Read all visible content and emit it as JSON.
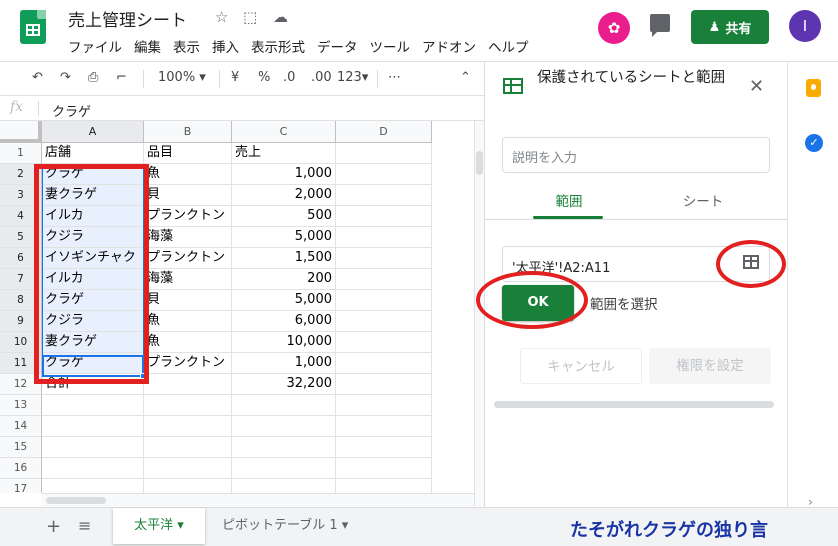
{
  "app": {
    "title": "売上管理シート",
    "menus": [
      "ファイル",
      "編集",
      "表示",
      "挿入",
      "表示形式",
      "データ",
      "ツール",
      "アドオン",
      "ヘルプ"
    ],
    "share_label": "共有",
    "user_initial": "I"
  },
  "toolbar": {
    "zoom": "100%",
    "currency": "¥",
    "percent": "%",
    "dec_less": ".0",
    "dec_more": ".00",
    "format": "123"
  },
  "formula": {
    "fx": "fx",
    "value": "クラゲ"
  },
  "grid": {
    "columns": [
      "A",
      "B",
      "C",
      "D"
    ],
    "rows": [
      "1",
      "2",
      "3",
      "4",
      "5",
      "6",
      "7",
      "8",
      "9",
      "10",
      "11",
      "12",
      "13",
      "14",
      "15",
      "16",
      "17"
    ],
    "data": [
      [
        "店舗",
        "品目",
        "売上"
      ],
      [
        "クラゲ",
        "魚",
        "1,000"
      ],
      [
        "妻クラゲ",
        "貝",
        "2,000"
      ],
      [
        "イルカ",
        "プランクトン",
        "500"
      ],
      [
        "クジラ",
        "海藻",
        "5,000"
      ],
      [
        "イソギンチャク",
        "プランクトン",
        "1,500"
      ],
      [
        "イルカ",
        "海藻",
        "200"
      ],
      [
        "クラゲ",
        "貝",
        "5,000"
      ],
      [
        "クジラ",
        "魚",
        "6,000"
      ],
      [
        "妻クラゲ",
        "魚",
        "10,000"
      ],
      [
        "クラゲ",
        "プランクトン",
        "1,000"
      ],
      [
        "合計",
        "",
        "32,200"
      ]
    ]
  },
  "sheets": {
    "active": "太平洋",
    "other": "ピボットテーブル 1"
  },
  "watermark": "たそがれクラゲの独り言",
  "panel": {
    "title": "保護されているシートと範囲",
    "desc_placeholder": "説明を入力",
    "tab_range": "範囲",
    "tab_sheet": "シート",
    "range_value": "'太平洋'!A2:A11",
    "ok_label": "OK",
    "select_hint": "範囲を選択",
    "cancel_label": "キャンセル",
    "perm_label": "権限を設定"
  },
  "colors": {
    "accent": "#188038",
    "selection": "#1a73e8",
    "annotation": "#e1201f"
  }
}
